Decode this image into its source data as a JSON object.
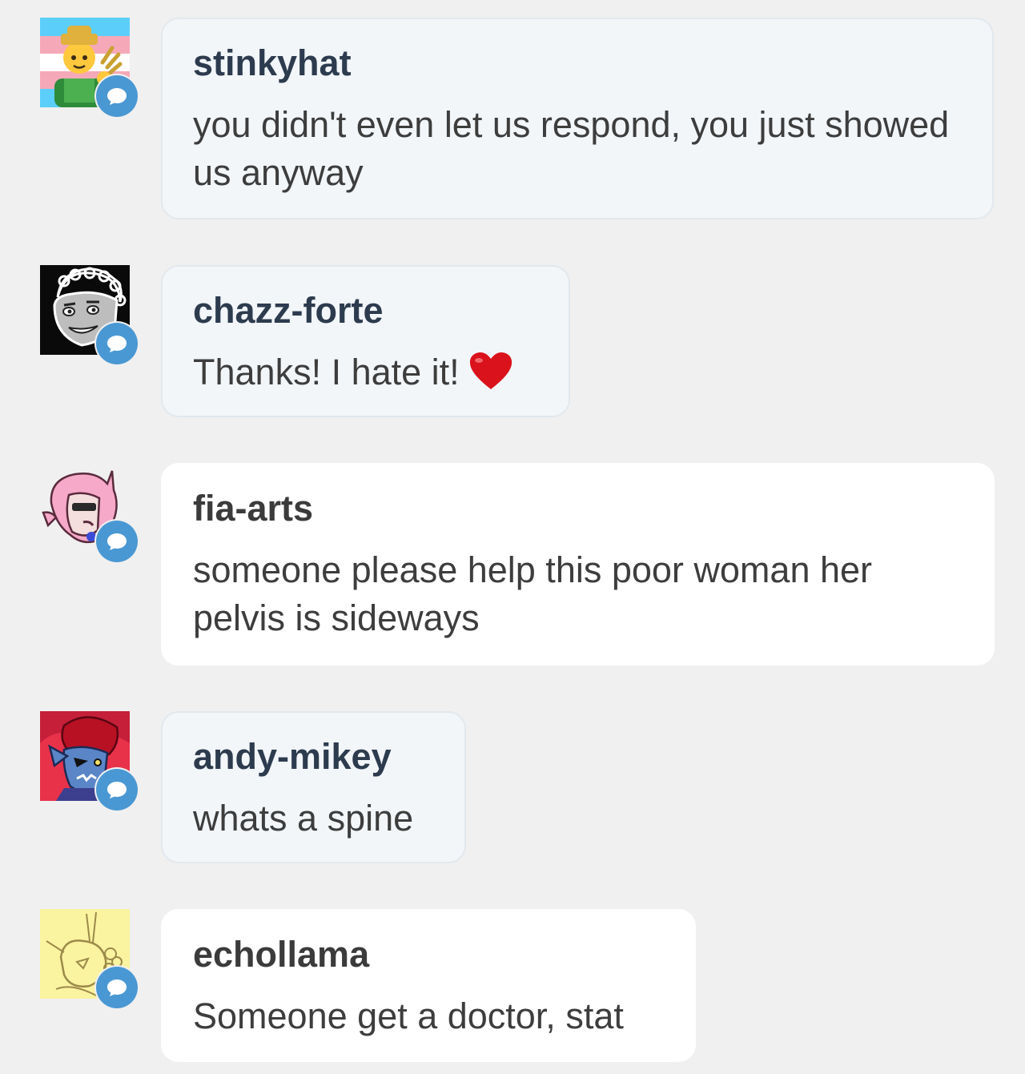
{
  "colors": {
    "page_background": "#f0f0f0",
    "bubble_tinted": "#f2f6f9",
    "bubble_plain": "#ffffff",
    "badge_blue": "#4a98d3",
    "username_text": "#2d3b4e",
    "message_text": "#3d3d3d",
    "heart_red": "#d9121b"
  },
  "replies": [
    {
      "username": "stinkyhat",
      "message": "you didn't even let us respond, you just showed us anyway",
      "avatar_icon": "farmer-emoji-trans-flag-avatar",
      "badge_icon": "speech-bubble-icon"
    },
    {
      "username": "chazz-forte",
      "message": "Thanks! I hate it!",
      "message_emoji": "heart-icon",
      "avatar_icon": "grayscale-cartoon-face-avatar",
      "badge_icon": "speech-bubble-icon"
    },
    {
      "username": "fia-arts",
      "message": "someone please help this poor woman her pelvis is sideways",
      "avatar_icon": "pink-hair-character-avatar",
      "badge_icon": "speech-bubble-icon"
    },
    {
      "username": "andy-mikey",
      "message": "whats a spine",
      "avatar_icon": "blue-fish-warrior-avatar",
      "badge_icon": "speech-bubble-icon"
    },
    {
      "username": "echollama",
      "message": "Someone get a doctor, stat",
      "avatar_icon": "llama-sketch-avatar",
      "badge_icon": "speech-bubble-icon"
    }
  ]
}
